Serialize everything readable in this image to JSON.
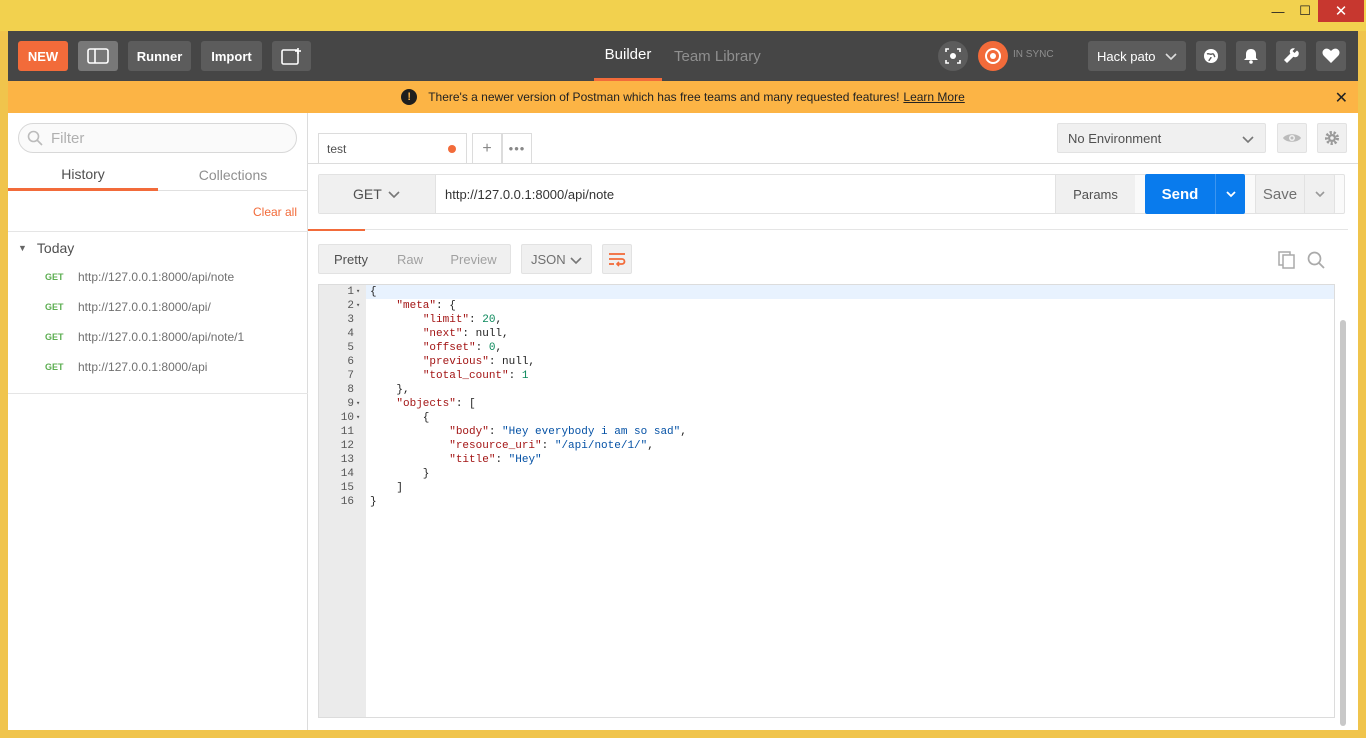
{
  "window": {
    "minimize": "—",
    "maximize": "☐",
    "close": "✕"
  },
  "header": {
    "new_label": "NEW",
    "runner_label": "Runner",
    "import_label": "Import",
    "tab_builder": "Builder",
    "tab_team_library": "Team Library",
    "sync_status": "IN SYNC",
    "user_label": "Hack pato"
  },
  "banner": {
    "message": "There's a newer version of Postman which has free teams and many requested features!",
    "link": "Learn More",
    "close": "✕"
  },
  "sidebar": {
    "filter_placeholder": "Filter",
    "tab_history": "History",
    "tab_collections": "Collections",
    "clear_all": "Clear all",
    "group_label": "Today",
    "items": [
      {
        "method": "GET",
        "url": "http://127.0.0.1:8000/api/note"
      },
      {
        "method": "GET",
        "url": "http://127.0.0.1:8000/api/"
      },
      {
        "method": "GET",
        "url": "http://127.0.0.1:8000/api/note/1"
      },
      {
        "method": "GET",
        "url": "http://127.0.0.1:8000/api"
      }
    ]
  },
  "request": {
    "tab_name": "test",
    "tab_add": "+",
    "tab_more": "•••",
    "environment": "No Environment",
    "method": "GET",
    "url": "http://127.0.0.1:8000/api/note",
    "params_label": "Params",
    "send_label": "Send",
    "save_label": "Save"
  },
  "response": {
    "view_pretty": "Pretty",
    "view_raw": "Raw",
    "view_preview": "Preview",
    "language": "JSON",
    "lines": [
      {
        "num": "1",
        "fold": "▾",
        "tokens": [
          [
            "p",
            "{"
          ]
        ]
      },
      {
        "num": "2",
        "fold": "▾",
        "tokens": [
          [
            "p",
            "    "
          ],
          [
            "k",
            "\"meta\""
          ],
          [
            "p",
            ": {"
          ]
        ]
      },
      {
        "num": "3",
        "fold": "",
        "tokens": [
          [
            "p",
            "        "
          ],
          [
            "k",
            "\"limit\""
          ],
          [
            "p",
            ": "
          ],
          [
            "n",
            "20"
          ],
          [
            "p",
            ","
          ]
        ]
      },
      {
        "num": "4",
        "fold": "",
        "tokens": [
          [
            "p",
            "        "
          ],
          [
            "k",
            "\"next\""
          ],
          [
            "p",
            ": null,"
          ]
        ]
      },
      {
        "num": "5",
        "fold": "",
        "tokens": [
          [
            "p",
            "        "
          ],
          [
            "k",
            "\"offset\""
          ],
          [
            "p",
            ": "
          ],
          [
            "n",
            "0"
          ],
          [
            "p",
            ","
          ]
        ]
      },
      {
        "num": "6",
        "fold": "",
        "tokens": [
          [
            "p",
            "        "
          ],
          [
            "k",
            "\"previous\""
          ],
          [
            "p",
            ": null,"
          ]
        ]
      },
      {
        "num": "7",
        "fold": "",
        "tokens": [
          [
            "p",
            "        "
          ],
          [
            "k",
            "\"total_count\""
          ],
          [
            "p",
            ": "
          ],
          [
            "n",
            "1"
          ]
        ]
      },
      {
        "num": "8",
        "fold": "",
        "tokens": [
          [
            "p",
            "    },"
          ]
        ]
      },
      {
        "num": "9",
        "fold": "▾",
        "tokens": [
          [
            "p",
            "    "
          ],
          [
            "k",
            "\"objects\""
          ],
          [
            "p",
            ": ["
          ]
        ]
      },
      {
        "num": "10",
        "fold": "▾",
        "tokens": [
          [
            "p",
            "        {"
          ]
        ]
      },
      {
        "num": "11",
        "fold": "",
        "tokens": [
          [
            "p",
            "            "
          ],
          [
            "k",
            "\"body\""
          ],
          [
            "p",
            ": "
          ],
          [
            "s",
            "\"Hey everybody i am so sad\""
          ],
          [
            "p",
            ","
          ]
        ]
      },
      {
        "num": "12",
        "fold": "",
        "tokens": [
          [
            "p",
            "            "
          ],
          [
            "k",
            "\"resource_uri\""
          ],
          [
            "p",
            ": "
          ],
          [
            "s",
            "\"/api/note/1/\""
          ],
          [
            "p",
            ","
          ]
        ]
      },
      {
        "num": "13",
        "fold": "",
        "tokens": [
          [
            "p",
            "            "
          ],
          [
            "k",
            "\"title\""
          ],
          [
            "p",
            ": "
          ],
          [
            "s",
            "\"Hey\""
          ]
        ]
      },
      {
        "num": "14",
        "fold": "",
        "tokens": [
          [
            "p",
            "        }"
          ]
        ]
      },
      {
        "num": "15",
        "fold": "",
        "tokens": [
          [
            "p",
            "    ]"
          ]
        ]
      },
      {
        "num": "16",
        "fold": "",
        "tokens": [
          [
            "p",
            "}"
          ]
        ]
      }
    ]
  },
  "colors": {
    "accent": "#f26b3a",
    "send_blue": "#097bed",
    "banner": "#fcb445",
    "header_bg": "#464646",
    "get_green": "#5cae51"
  }
}
